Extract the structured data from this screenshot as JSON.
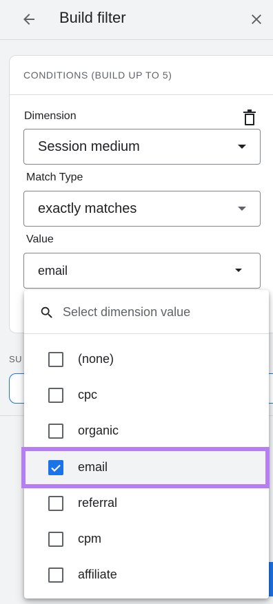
{
  "header": {
    "title": "Build filter",
    "back_icon": "arrow-left-icon",
    "close_icon": "close-icon"
  },
  "conditions": {
    "title": "CONDITIONS (BUILD UP TO 5)",
    "delete_icon": "trash-icon",
    "dimension": {
      "label": "Dimension",
      "value": "Session medium"
    },
    "match_type": {
      "label": "Match Type",
      "value": "exactly matches"
    },
    "value_field": {
      "label": "Value",
      "value": "email"
    }
  },
  "background": {
    "section_label": "SU"
  },
  "dropdown": {
    "search_placeholder": "Select dimension value",
    "options": [
      {
        "label": "(none)",
        "checked": false
      },
      {
        "label": "cpc",
        "checked": false
      },
      {
        "label": "organic",
        "checked": false
      },
      {
        "label": "email",
        "checked": true
      },
      {
        "label": "referral",
        "checked": false
      },
      {
        "label": "cpm",
        "checked": false
      },
      {
        "label": "affiliate",
        "checked": false
      }
    ]
  },
  "colors": {
    "accent": "#1a73e8",
    "highlight": "#b57ef7",
    "text": "#202124",
    "muted": "#5f6368"
  }
}
